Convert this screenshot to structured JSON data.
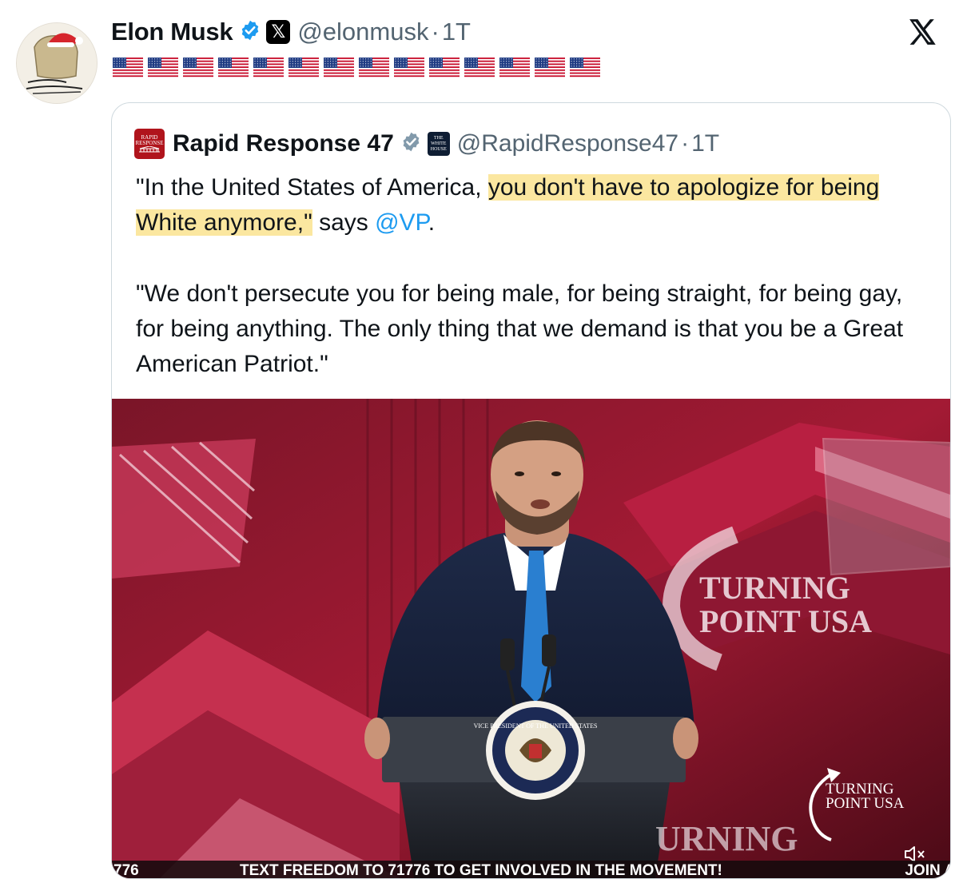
{
  "post": {
    "author_name": "Elon Musk",
    "handle": "@elonmusk",
    "separator": "·",
    "time": "1T",
    "flags": [
      "🇺🇸",
      "🇺🇸",
      "🇺🇸",
      "🇺🇸",
      "🇺🇸",
      "🇺🇸",
      "🇺🇸",
      "🇺🇸",
      "🇺🇸",
      "🇺🇸",
      "🇺🇸",
      "🇺🇸",
      "🇺🇸",
      "🇺🇸"
    ],
    "affiliation_badge": "𝕏"
  },
  "quoted": {
    "author_name": "Rapid Response 47",
    "handle": "@RapidResponse47",
    "separator": "·",
    "time": "1T",
    "logo_text_1": "RAPID",
    "logo_text_2": "RESPONSE",
    "affiliation_badge_text_1": "THE",
    "affiliation_badge_text_2": "WHITE",
    "affiliation_badge_text_3": "HOUSE",
    "para1_before": "\"In the United States of America, ",
    "para1_highlight": "you don't have to apologize for being White anymore,\"",
    "para1_after_a": " says ",
    "para1_mention": "@VP",
    "para1_after_b": ".",
    "para2": "\"We don't persecute you for being male, for being straight, for being gay, for being anything. The only thing that we demand is that you be a Great American Patriot.\""
  },
  "video": {
    "backdrop_text_1": "TURNING",
    "backdrop_text_2": "POINT USA",
    "watermark_1": "TURNING",
    "watermark_2": "POINT USA",
    "lower_text": "URNING",
    "seal_text": "VICE PRESIDENT OF THE UNITED STATES",
    "ticker_left": "776",
    "ticker_main": "TEXT FREEDOM TO 71776 TO GET INVOLVED IN THE MOVEMENT!",
    "ticker_right": "JOIN A"
  },
  "colors": {
    "verified": "#1d9bf0",
    "gray_text": "#536471",
    "highlight": "#fbe7a0",
    "mention": "#1d9bf0"
  },
  "icons": {
    "close": "x-logo-icon",
    "mute": "speaker-muted-icon"
  }
}
